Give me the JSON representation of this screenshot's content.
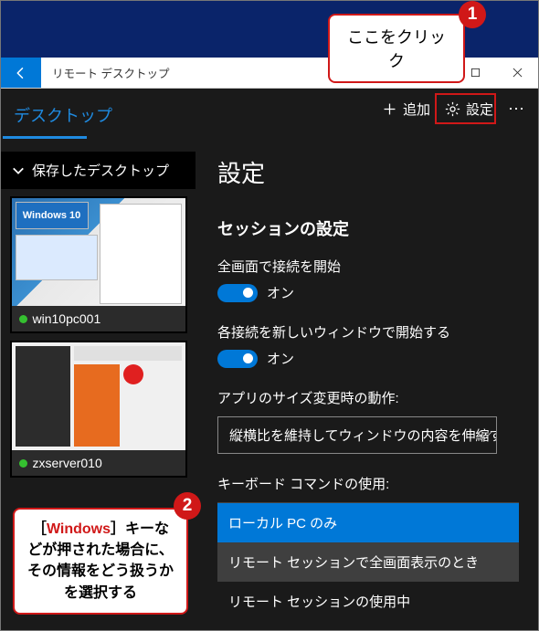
{
  "window": {
    "title": "リモート デスクトップ"
  },
  "sidebar": {
    "tab_label": "デスクトップ",
    "section_label": "保存したデスクトップ",
    "items": [
      {
        "name": "win10pc001"
      },
      {
        "name": "zxserver010"
      }
    ]
  },
  "toolbar": {
    "add_label": "追加",
    "settings_label": "設定"
  },
  "settings": {
    "title": "設定",
    "session_section_title": "セッションの設定",
    "fullscreen": {
      "label": "全画面で接続を開始",
      "state": "オン"
    },
    "new_window": {
      "label": "各接続を新しいウィンドウで開始する",
      "state": "オン"
    },
    "resize": {
      "label": "アプリのサイズ変更時の動作:",
      "value": "縦横比を維持してウィンドウの内容を伸縮す"
    },
    "keyboard": {
      "label": "キーボード コマンドの使用:",
      "options": [
        "ローカル PC のみ",
        "リモート セッションで全画面表示のとき",
        "リモート セッションの使用中"
      ],
      "selected_index": 0
    }
  },
  "annotations": {
    "callout1": "ここをクリック",
    "badge1": "1",
    "callout2_pre": "［",
    "callout2_hl": "Windows",
    "callout2_post": "］キーなどが押された場合に、その情報をどう扱うかを選択する",
    "badge2": "2"
  }
}
